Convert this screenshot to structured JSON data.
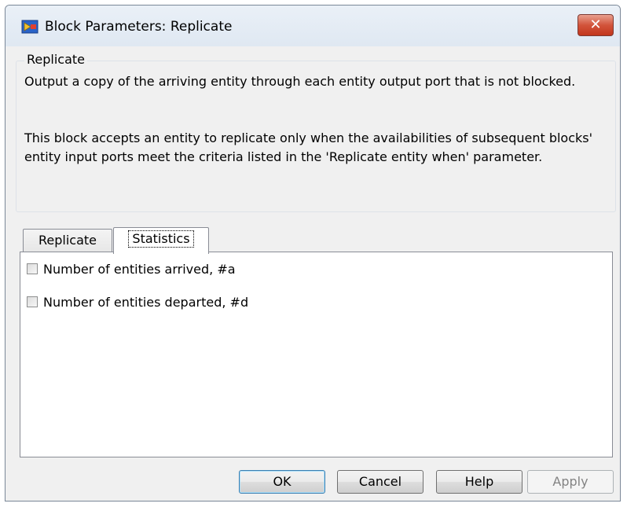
{
  "window": {
    "title": "Block Parameters: Replicate",
    "icon": "simulink-block-icon",
    "close_label": "✕"
  },
  "description": {
    "group_title": "Replicate",
    "paragraph1": "Output a copy of the arriving entity through each entity output port that is not blocked.",
    "paragraph2": "This block accepts an entity to replicate only when the availabilities of subsequent blocks' entity input ports meet the criteria listed in the 'Replicate entity when' parameter."
  },
  "tabs": [
    {
      "label": "Replicate",
      "selected": false
    },
    {
      "label": "Statistics",
      "selected": true
    }
  ],
  "statistics": {
    "options": [
      {
        "label": "Number of entities arrived, #a",
        "checked": false
      },
      {
        "label": "Number of entities departed, #d",
        "checked": false
      }
    ]
  },
  "buttons": {
    "ok": "OK",
    "cancel": "Cancel",
    "help": "Help",
    "apply": "Apply"
  },
  "colors": {
    "close_button": "#c2361c",
    "default_button_border": "#3c7fb1",
    "disabled_text": "#838383"
  }
}
